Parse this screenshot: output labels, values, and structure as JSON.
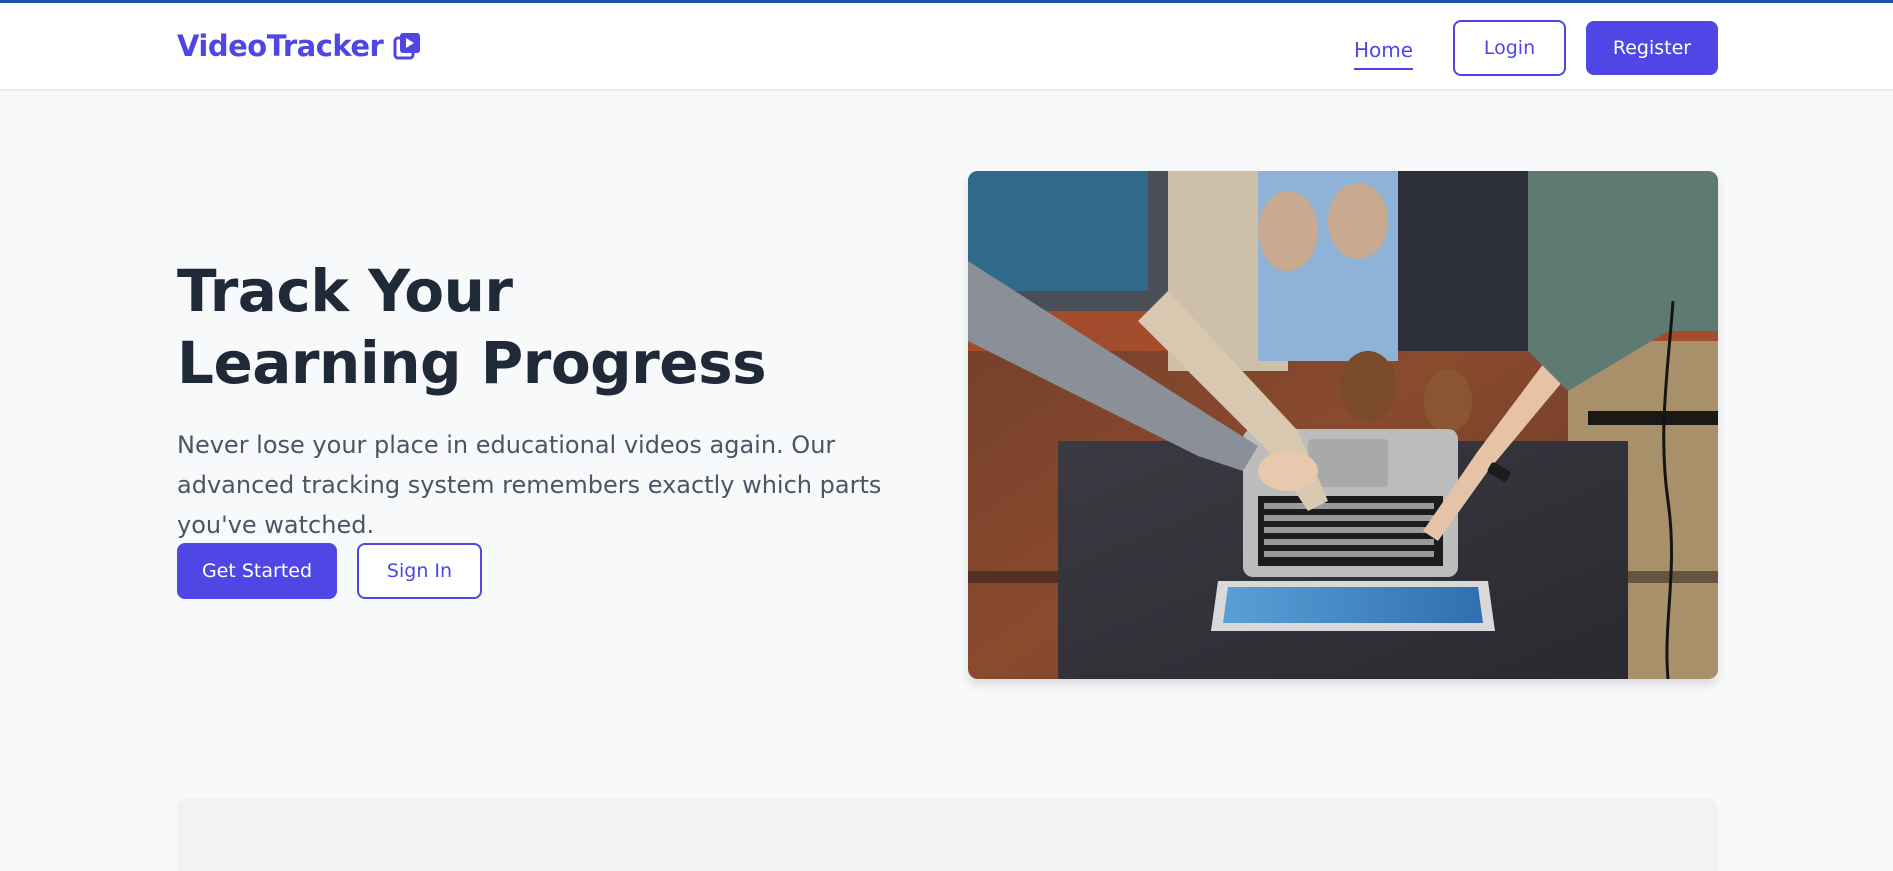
{
  "brand": {
    "name": "VideoTracker",
    "icon": "play-video-icon",
    "color": "#4f46e5"
  },
  "nav": {
    "home": "Home",
    "login": "Login",
    "register": "Register"
  },
  "hero": {
    "title": "Track Your Learning Progress",
    "subtitle": "Never lose your place in educational videos again. Our advanced tracking system remembers exactly which parts you've watched.",
    "primary_cta": "Get Started",
    "secondary_cta": "Sign In",
    "image": "students-pointing-at-laptop-photo"
  },
  "colors": {
    "accent": "#4f46e5",
    "heading": "#1f2937",
    "body_text": "#4b5563",
    "background": "#f8f9fb"
  }
}
